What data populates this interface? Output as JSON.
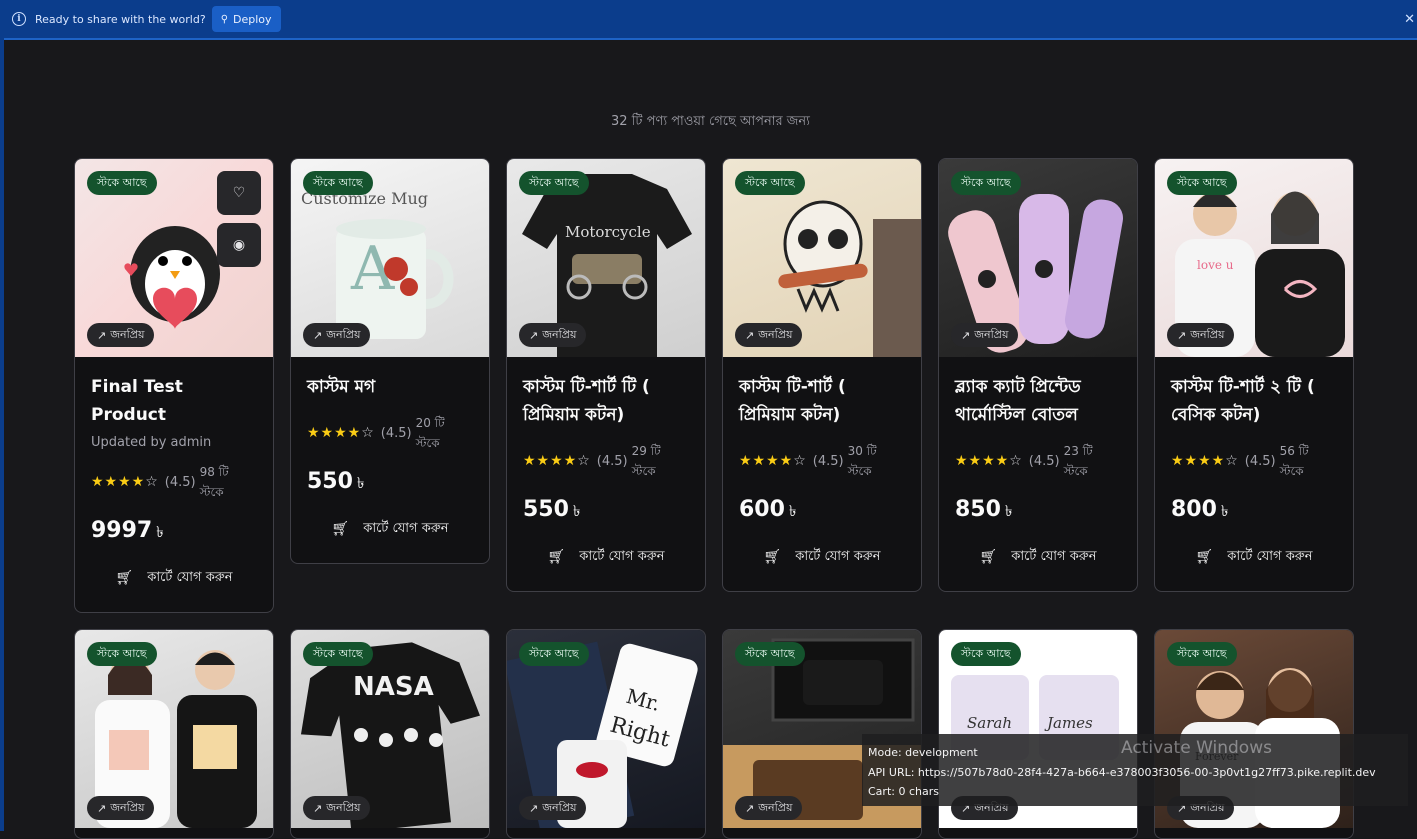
{
  "deploy_bar": {
    "message": "Ready to share with the world?",
    "button_label": "Deploy"
  },
  "results_text": "32 টি পণ্য পাওয়া গেছে আপনার জন্য",
  "labels": {
    "in_stock": "স্টকে আছে",
    "popular": "জনপ্রিয়",
    "add_to_cart": "কার্টে যোগ করুন",
    "currency": "৳"
  },
  "products": [
    {
      "title": "Final Test Product",
      "subtitle": "Updated by admin",
      "rating": "(4.5)",
      "stock": "98 টি স্টকে",
      "price": "9997"
    },
    {
      "title": "কাস্টম মগ",
      "subtitle": "",
      "rating": "(4.5)",
      "stock": "20 টি স্টকে",
      "price": "550"
    },
    {
      "title": "কাস্টম টি-শার্ট টি ( প্রিমিয়াম কটন)",
      "subtitle": "",
      "rating": "(4.5)",
      "stock": "29 টি স্টকে",
      "price": "550"
    },
    {
      "title": "কাস্টম টি-শার্ট ( প্রিমিয়াম কটন)",
      "subtitle": "",
      "rating": "(4.5)",
      "stock": "30 টি স্টকে",
      "price": "600"
    },
    {
      "title": "ব্ল্যাক ক্যাট প্রিন্টেড থার্মোস্টিল বোতল",
      "subtitle": "",
      "rating": "(4.5)",
      "stock": "23 টি স্টকে",
      "price": "850"
    },
    {
      "title": "কাস্টম টি-শার্ট ২ টি ( বেসিক কটন)",
      "subtitle": "",
      "rating": "(4.5)",
      "stock": "56 টি স্টকে",
      "price": "800"
    }
  ],
  "debug": {
    "mode": "Mode: development",
    "api": "API URL: https://507b78d0-28f4-427a-b664-e378003f3056-00-3p0vt1g27ff73.pike.replit.dev",
    "cart": "Cart: 0 chars"
  },
  "watermark": "Activate Windows"
}
